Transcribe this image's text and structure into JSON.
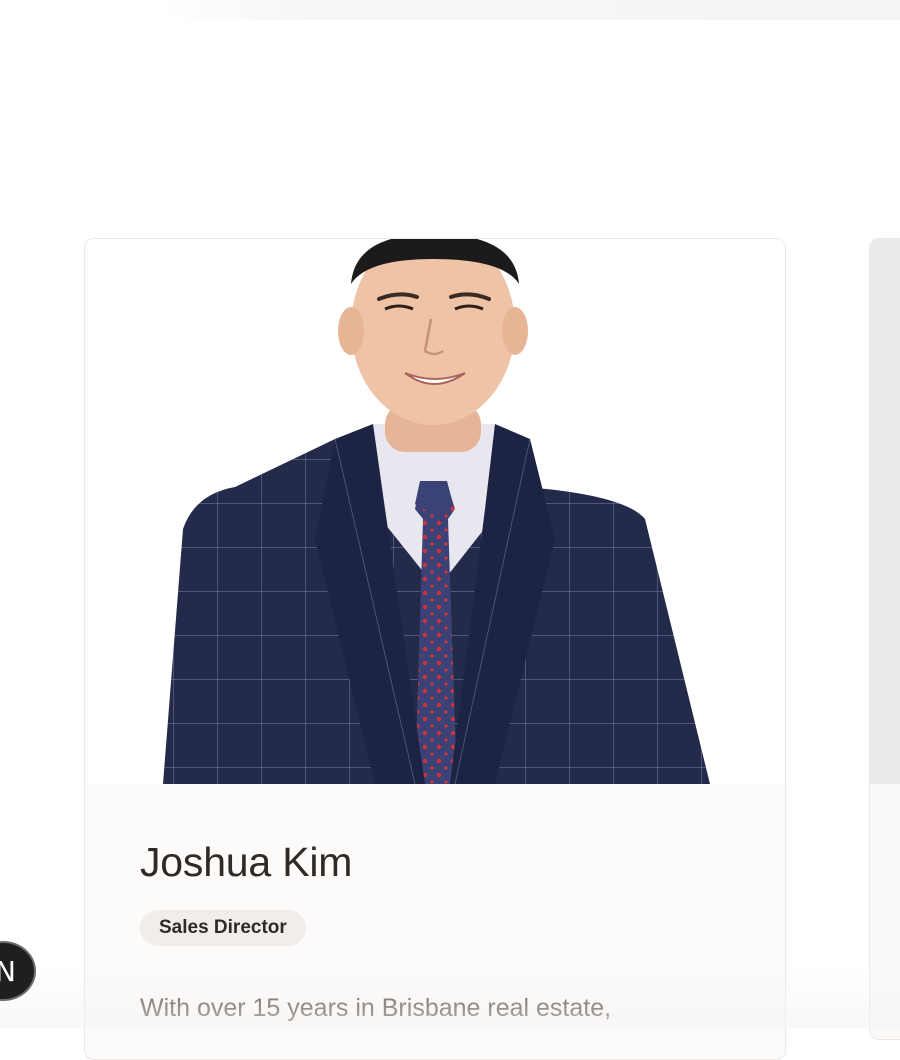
{
  "agent": {
    "name": "Joshua Kim",
    "role": "Sales Director",
    "bio": "With over 15 years in Brisbane real estate,"
  },
  "dev_badge": {
    "glyph": "N"
  },
  "colors": {
    "card_background": "#fcfbfa",
    "badge_background": "#f0edeb",
    "text_primary": "#2f2a28",
    "text_secondary": "#5a4f4a",
    "suit": "#232a4a",
    "tie": "#3b4275",
    "tie_pattern": "#d2323a"
  }
}
